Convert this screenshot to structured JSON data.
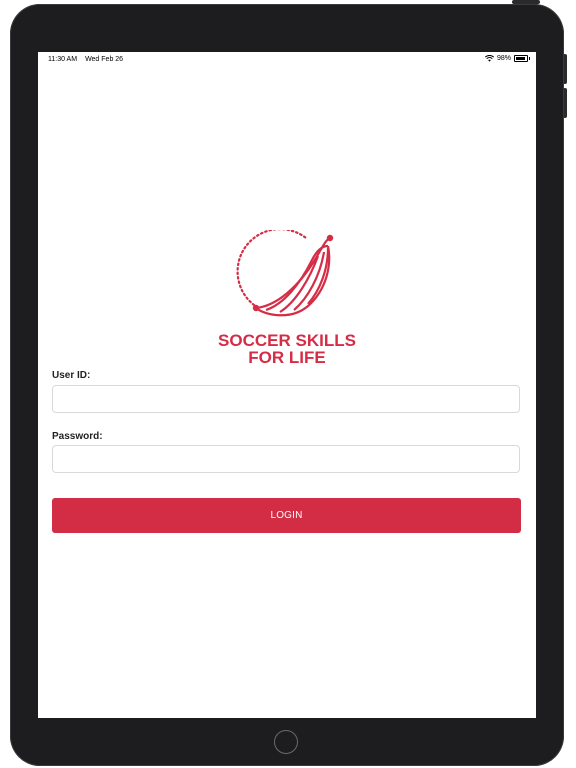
{
  "statusbar": {
    "time": "11:30 AM",
    "date": "Wed Feb 26",
    "battery_level": "98%",
    "battery_fraction": 0.98,
    "wifi_icon": "wifi-icon",
    "battery_icon": "battery-icon"
  },
  "logo": {
    "line1": "SOCCER SKILLS",
    "line2": "FOR LIFE",
    "color": "#d62d46",
    "icon": "soccer-ball-swoosh-icon"
  },
  "form": {
    "user_id_label": "User ID:",
    "user_id_value": "",
    "password_label": "Password:",
    "password_value": "",
    "login_label": "LOGIN",
    "button_color": "#d22d45"
  }
}
